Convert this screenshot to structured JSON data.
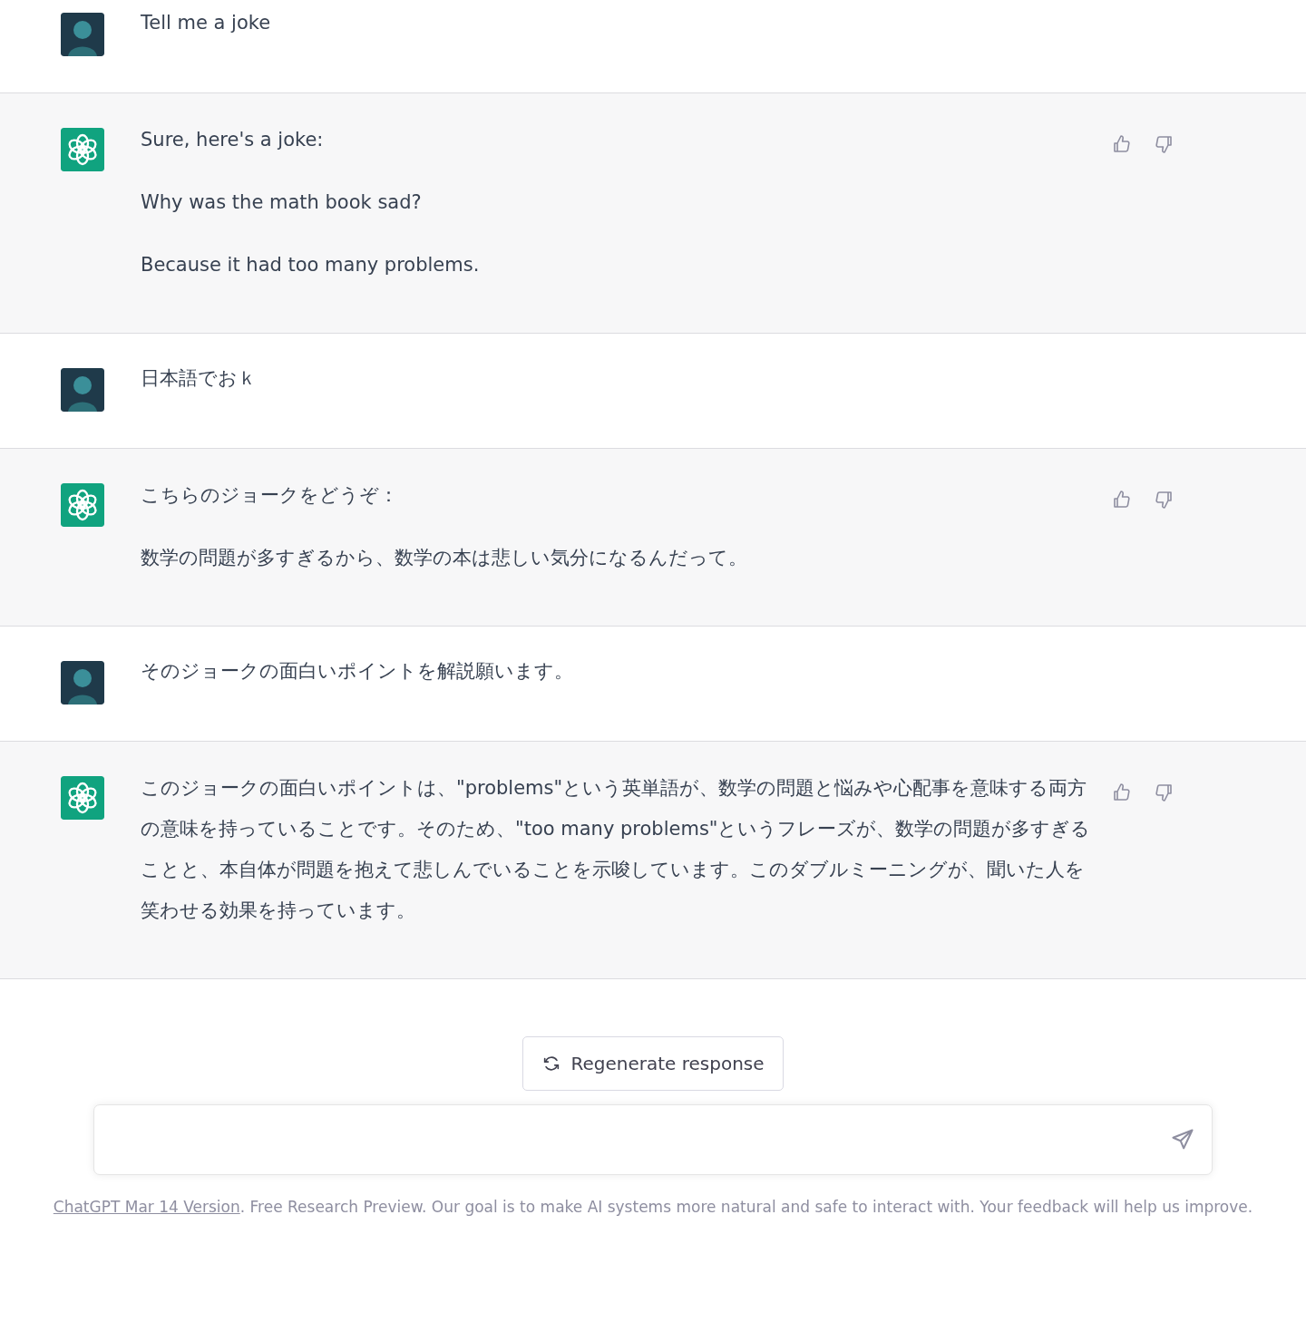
{
  "messages": [
    {
      "kind": "user",
      "paragraphs": [
        "Tell me a joke"
      ]
    },
    {
      "kind": "assistant",
      "paragraphs": [
        "Sure, here's a joke:",
        "Why was the math book sad?",
        "Because it had too many problems."
      ]
    },
    {
      "kind": "user",
      "paragraphs": [
        "日本語でおｋ"
      ]
    },
    {
      "kind": "assistant",
      "paragraphs": [
        "こちらのジョークをどうぞ：",
        "数学の問題が多すぎるから、数学の本は悲しい気分になるんだって。"
      ]
    },
    {
      "kind": "user",
      "paragraphs": [
        "そのジョークの面白いポイントを解説願います。"
      ]
    },
    {
      "kind": "assistant",
      "paragraphs": [
        "このジョークの面白いポイントは、\"problems\"という英単語が、数学の問題と悩みや心配事を意味する両方の意味を持っていることです。そのため、\"too many problems\"というフレーズが、数学の問題が多すぎることと、本自体が問題を抱えて悲しんでいることを示唆しています。このダブルミーニングが、聞いた人を笑わせる効果を持っています。"
      ]
    }
  ],
  "regenerate_button": "Regenerate response",
  "footer": {
    "link": "ChatGPT Mar 14 Version",
    "text": ". Free Research Preview. Our goal is to make AI systems more natural and safe to interact with. Your feedback will help us improve."
  }
}
